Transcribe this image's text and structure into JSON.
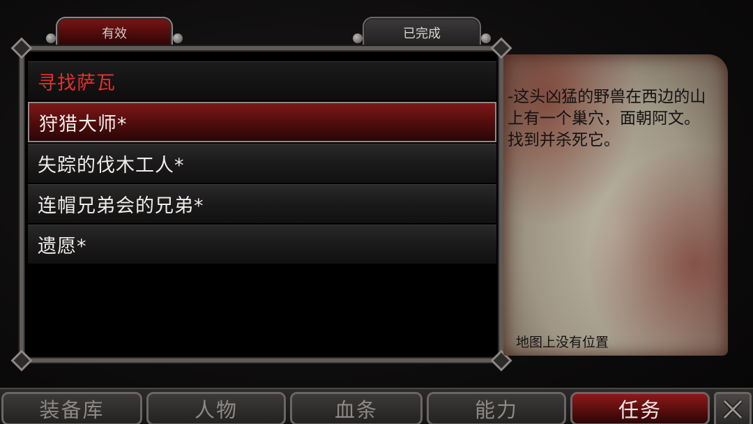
{
  "tabs": {
    "active_label": "有效",
    "completed_label": "已完成"
  },
  "quests": {
    "header": "寻找萨瓦",
    "items": [
      {
        "label": "狩猎大师*",
        "selected": true
      },
      {
        "label": "失踪的伐木工人*",
        "selected": false
      },
      {
        "label": "连帽兄弟会的兄弟*",
        "selected": false
      },
      {
        "label": "遗愿*",
        "selected": false
      }
    ]
  },
  "details": {
    "description": "-这头凶猛的野兽在西边的山上有一个巢穴，面朝阿文。 找到并杀死它。",
    "map_note": "地图上没有位置"
  },
  "nav": {
    "inventory": "装备库",
    "character": "人物",
    "health": "血条",
    "abilities": "能力",
    "quests": "任务"
  },
  "icons": {
    "close": "close-icon"
  },
  "colors": {
    "accent_red": "#7e1717",
    "header_red": "#e03030"
  }
}
